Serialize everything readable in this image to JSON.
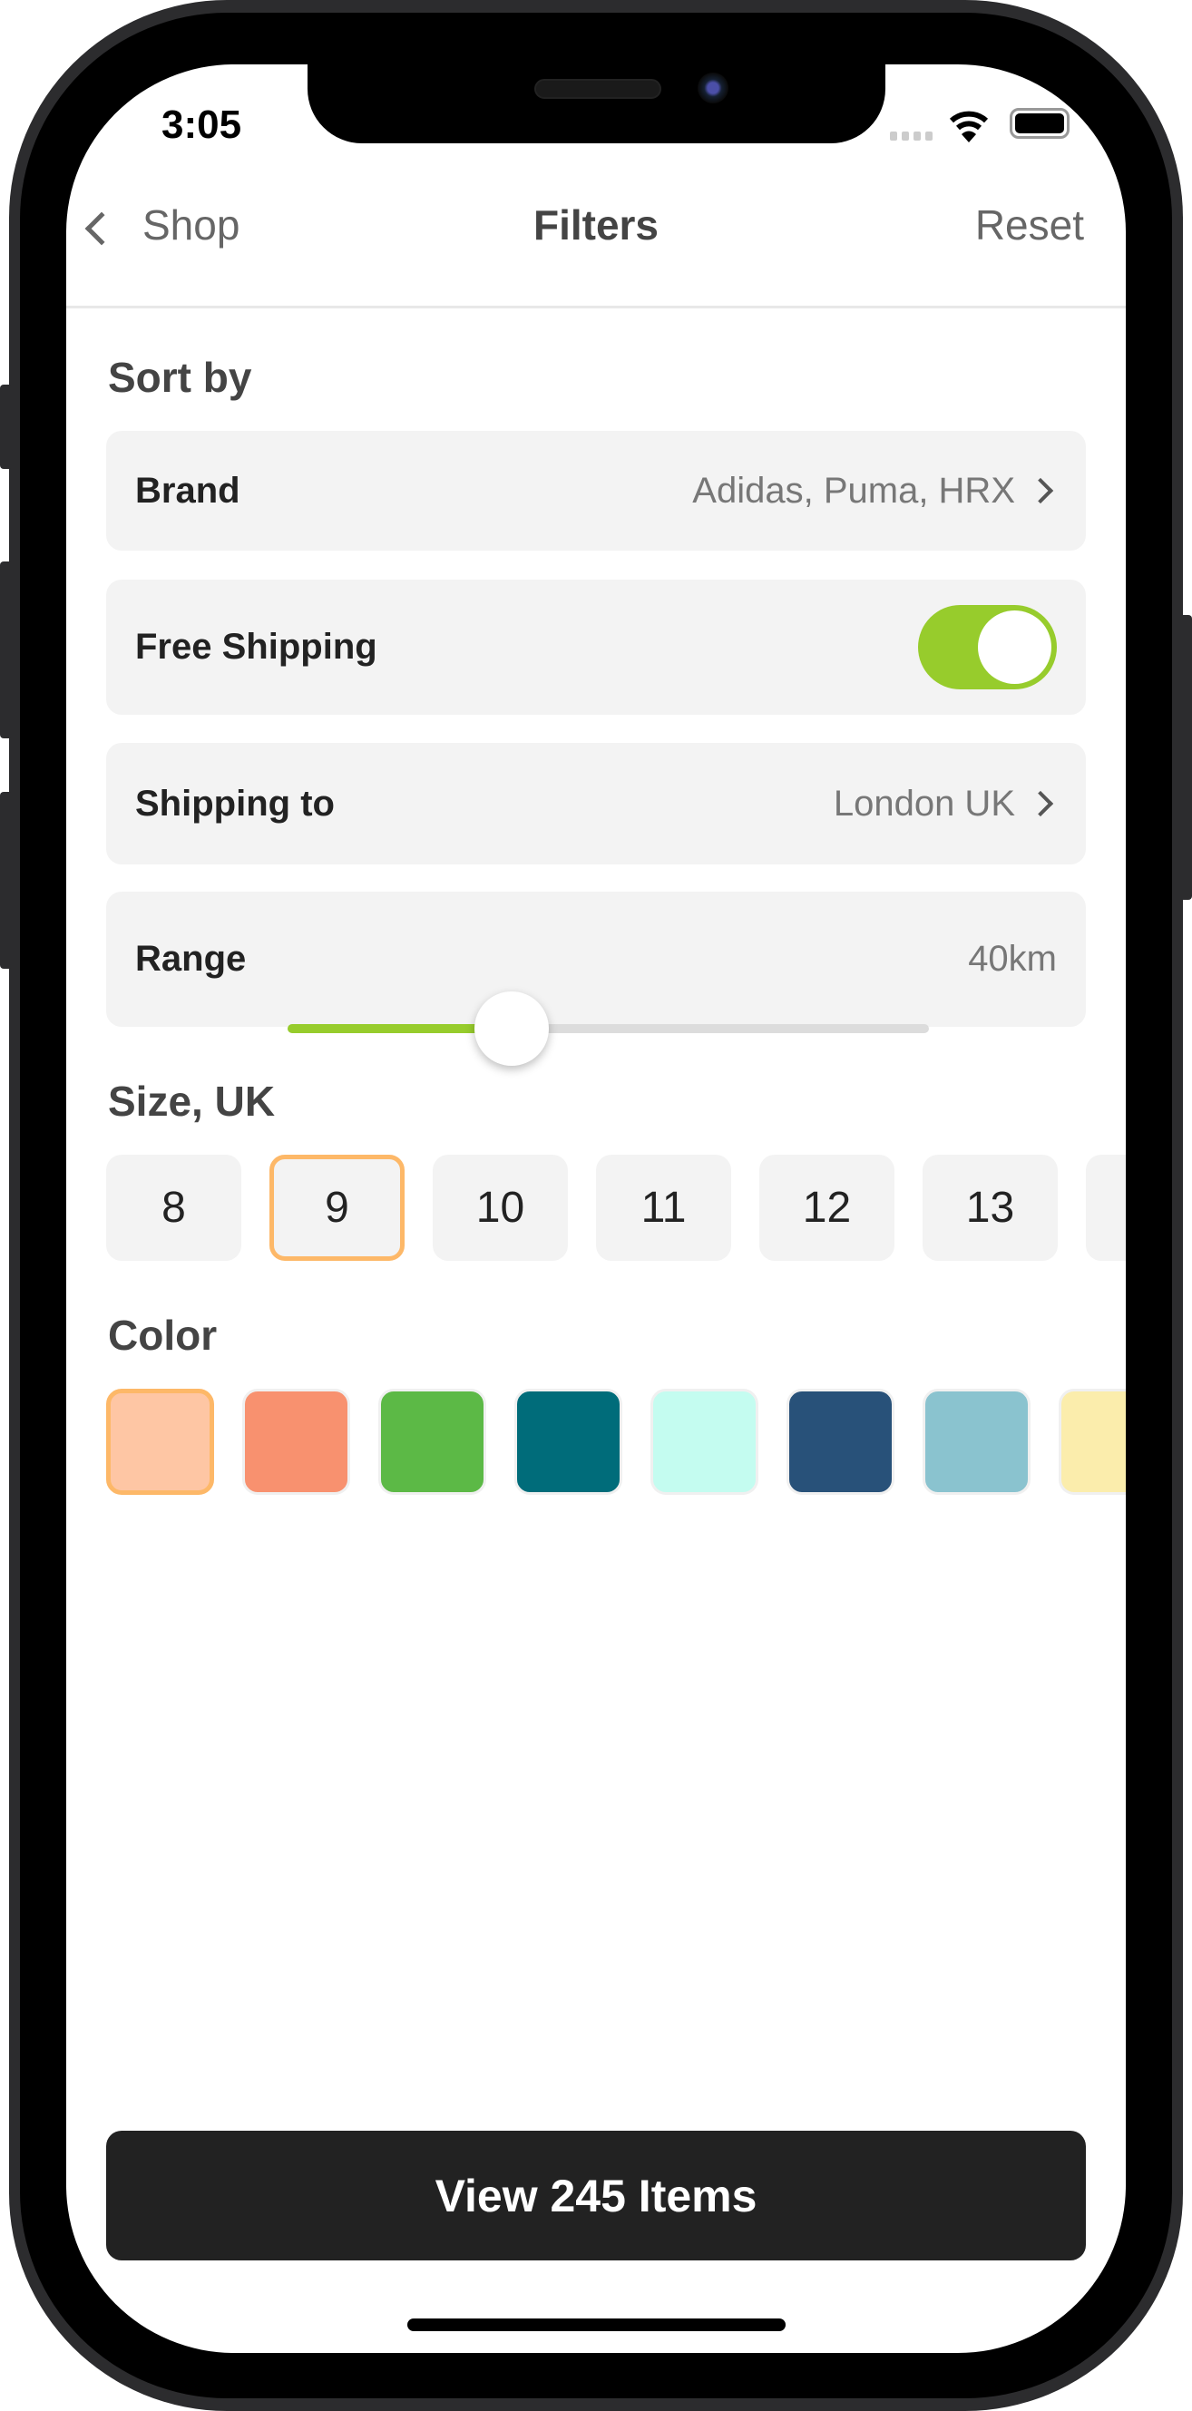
{
  "status_bar": {
    "time": "3:05"
  },
  "nav": {
    "back_label": "Shop",
    "title": "Filters",
    "reset_label": "Reset"
  },
  "sort_by": {
    "heading": "Sort by",
    "brand": {
      "label": "Brand",
      "value": "Adidas, Puma, HRX"
    },
    "free_shipping": {
      "label": "Free Shipping",
      "enabled": true
    },
    "shipping_to": {
      "label": "Shipping to",
      "value": "London UK"
    },
    "range": {
      "label": "Range",
      "value": "40km",
      "slider_fraction": 0.35
    }
  },
  "size": {
    "heading": "Size, UK",
    "options": [
      "8",
      "9",
      "10",
      "11",
      "12",
      "13",
      ""
    ],
    "selected": "9"
  },
  "color": {
    "heading": "Color",
    "swatches": [
      "#FEC6A4",
      "#F8916F",
      "#5CB946",
      "#006C7A",
      "#C4FCF0",
      "#285179",
      "#8AC3CF",
      "#FBEDAC"
    ],
    "selected_index": 0
  },
  "accent_color": "#97CC2C",
  "selection_color": "#FDB868",
  "cta": {
    "label": "View 245 Items"
  }
}
